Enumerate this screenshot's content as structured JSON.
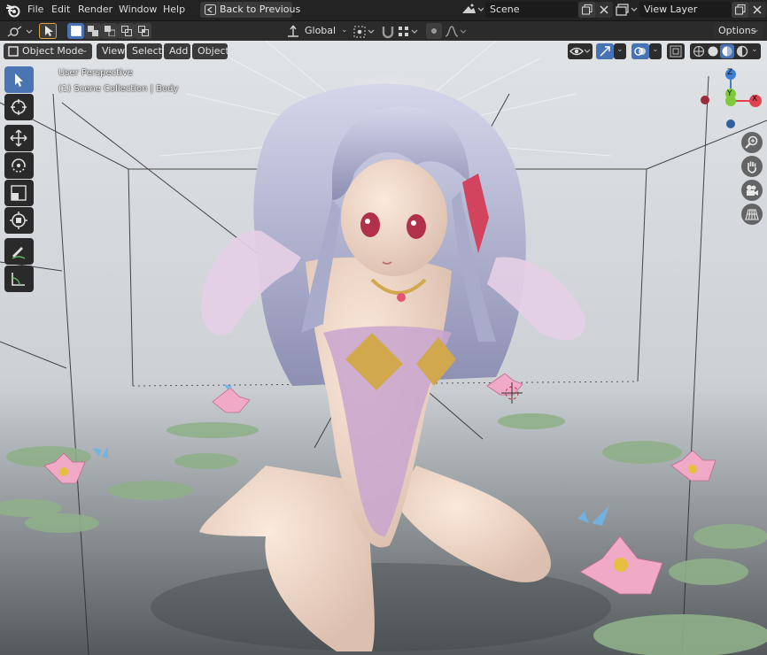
{
  "topbar": {
    "menu": [
      "File",
      "Edit",
      "Render",
      "Window",
      "Help"
    ],
    "back_button": "Back to Previous",
    "scene_name": "Scene",
    "view_layer_name": "View Layer"
  },
  "header": {
    "transform_orientation": "Global",
    "options_label": "Options"
  },
  "viewport_header": {
    "mode": "Object Mode",
    "menus": [
      "View",
      "Select",
      "Add",
      "Object"
    ]
  },
  "viewport": {
    "perspective_label": "User Perspective",
    "collection_label": "(1) Scene Collection | Body"
  },
  "gizmo": {
    "axis_z": "Z",
    "axis_y": "Y",
    "axis_x": "X"
  },
  "colors": {
    "accent": "#4772b3",
    "axis_x": "#e0434f",
    "axis_y": "#7fc93b",
    "axis_z": "#3b7ed6"
  }
}
